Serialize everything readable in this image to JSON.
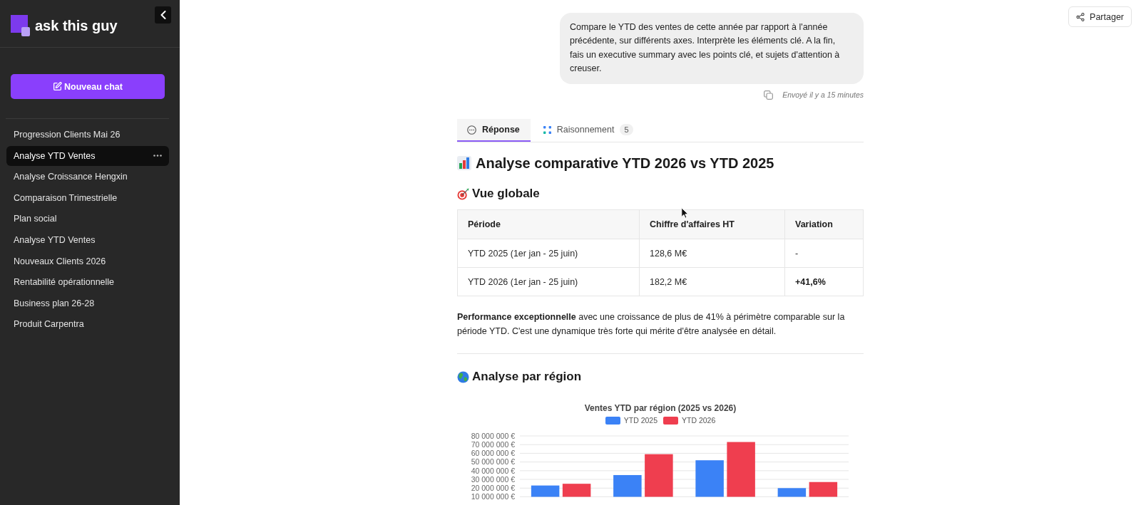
{
  "sidebar": {
    "logo_text": "ask this guy",
    "new_chat_label": "Nouveau chat",
    "conversations": [
      {
        "title": "Progression Clients Mai 26",
        "selected": false
      },
      {
        "title": "Analyse YTD Ventes",
        "selected": true
      },
      {
        "title": "Analyse Croissance Hengxin",
        "selected": false
      },
      {
        "title": "Comparaison Trimestrielle",
        "selected": false
      },
      {
        "title": "Plan social",
        "selected": false
      },
      {
        "title": "Analyse YTD Ventes",
        "selected": false
      },
      {
        "title": "Nouveaux Clients 2026",
        "selected": false
      },
      {
        "title": "Rentabilité opérationnelle",
        "selected": false
      },
      {
        "title": "Business plan 26-28",
        "selected": false
      },
      {
        "title": "Produit Carpentra",
        "selected": false
      }
    ]
  },
  "topbar": {
    "share_label": "Partager"
  },
  "user_message": {
    "text": "Compare le YTD des ventes de cette année par rapport à l'année précédente, sur différents axes. Interprète les éléments clé. A la fin, fais un executive summary avec les points clé, et sujets d'attention à creuser.",
    "sent_time": "Envoyé il y a 15 minutes"
  },
  "response_tabs": [
    {
      "label": "Réponse",
      "selected": true
    },
    {
      "label": "Raisonnement",
      "selected": false,
      "count": "5"
    }
  ],
  "answer": {
    "title": "Analyse comparative YTD 2026 vs YTD 2025",
    "overview": {
      "heading": "Vue globale",
      "table": {
        "columns": [
          "Période",
          "Chiffre d'affaires HT",
          "Variation"
        ],
        "rows": [
          {
            "cells": [
              "YTD 2025 (1er jan - 25 juin)",
              "128,6 M€",
              "-"
            ],
            "emphasized": false
          },
          {
            "cells": [
              "YTD 2026 (1er jan - 25 juin)",
              "182,2 M€",
              "+41,6%"
            ],
            "emphasized": true
          }
        ]
      },
      "paragraph": "**Performance exceptionnelle** avec une croissance de plus de 41% à périmètre comparable sur la période YTD. C'est une dynamique très forte qui mérite d'être analysée en détail."
    },
    "regions": {
      "heading": "Analyse par région",
      "chart_data": {
        "type": "bar",
        "title": "Ventes YTD par région (2025 vs 2026)",
        "stacked": false,
        "grid": true,
        "legend": "top",
        "series": [
          {
            "name": "YTD 2025",
            "color": "#3b82f6",
            "values": [
              23000000,
              35000000,
              52000000,
              20000000
            ]
          },
          {
            "name": "YTD 2026",
            "color": "#ef3e4f",
            "values": [
              25000000,
              59000000,
              73000000,
              27000000
            ]
          }
        ],
        "ylim": [
          10000000,
          80000000
        ],
        "yticks": [
          {
            "value": 80000000,
            "label": "80 000 000 €"
          },
          {
            "value": 70000000,
            "label": "70 000 000 €"
          },
          {
            "value": 60000000,
            "label": "60 000 000 €"
          },
          {
            "value": 50000000,
            "label": "50 000 000 €"
          },
          {
            "value": 40000000,
            "label": "40 000 000 €"
          },
          {
            "value": 30000000,
            "label": "30 000 000 €"
          },
          {
            "value": 20000000,
            "label": "20 000 000 €"
          },
          {
            "value": 10000000,
            "label": "10 000 000 €"
          }
        ]
      }
    }
  }
}
